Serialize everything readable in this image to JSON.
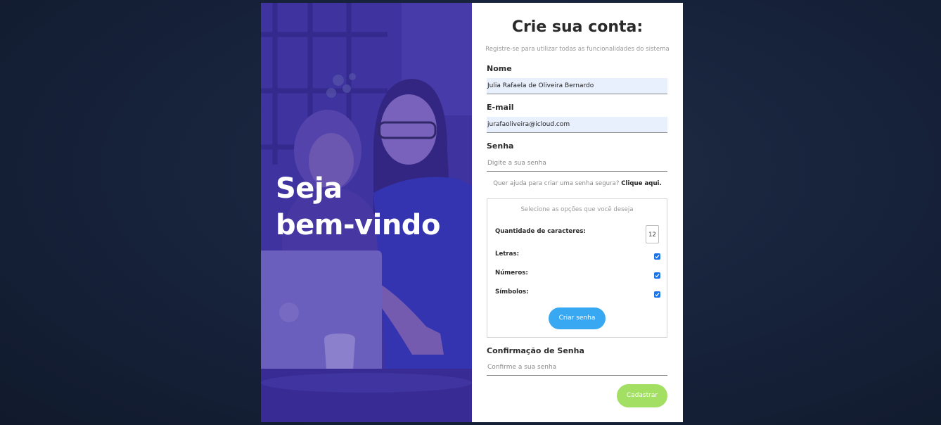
{
  "hero": {
    "line1": "Seja",
    "line2": "bem-vindo"
  },
  "form": {
    "title": "Crie sua conta:",
    "subtitle": "Registre-se para utilizar todas as funcionalidades do sistema",
    "name": {
      "label": "Nome",
      "value": "Julia Rafaela de Oliveira Bernardo"
    },
    "email": {
      "label": "E-mail",
      "value": "jurafaoliveira@icloud.com"
    },
    "password": {
      "label": "Senha",
      "placeholder": "Digite a sua senha"
    },
    "help": {
      "text": "Quer ajuda para criar uma senha segura?",
      "link": "Clique aqui."
    },
    "generator": {
      "title": "Selecione as opções que você deseja",
      "length_label": "Quantidade de caracteres:",
      "length_value": "12",
      "letters_label": "Letras:",
      "letters_checked": true,
      "numbers_label": "Números:",
      "numbers_checked": true,
      "symbols_label": "Símbolos:",
      "symbols_checked": true,
      "button": "Criar senha"
    },
    "confirm": {
      "label": "Confirmação de Senha",
      "placeholder": "Confirme a sua senha"
    },
    "submit": "Cadastrar"
  },
  "colors": {
    "page_bg": "#16213a",
    "hero_overlay": "#4a3fa8",
    "autofill_bg": "#e8f0fe",
    "create_button": "#38a8f2",
    "submit_button": "#a2df62",
    "checkbox": "#1a73e8"
  }
}
